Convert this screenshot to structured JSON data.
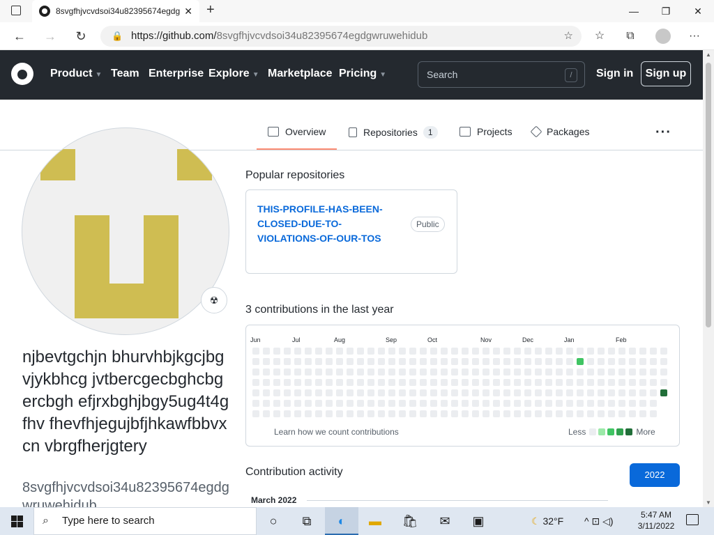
{
  "browser": {
    "tab_title": "8svgfhjvcvdsoi34u82395674egdgwruwehidub",
    "tab_close": "✕",
    "new_tab": "+",
    "url_host": "https://github.com/",
    "url_path": "8svgfhjvcvdsoi34u82395674egdgwruwehidub",
    "minimize": "—",
    "maximize": "❐",
    "close": "✕"
  },
  "header": {
    "nav": [
      "Product",
      "Team",
      "Enterprise",
      "Explore",
      "Marketplace",
      "Pricing"
    ],
    "search_placeholder": "Search",
    "search_key": "/",
    "sign_in": "Sign in",
    "sign_up": "Sign up"
  },
  "profile_tabs": {
    "overview": "Overview",
    "repositories": "Repositories",
    "repositories_count": "1",
    "projects": "Projects",
    "packages": "Packages",
    "more": "···"
  },
  "profile": {
    "name": "njbevtgchjn bhurvhbjkgcjbgvjykbhcg jvtbercgecbghcbgercbgh efjrxbghjbgy5ug4t4gfhv fhevfhjegujbfjhkawfbbvx cn vbrgfherjgtery",
    "login": "8svgfhjvcvdsoi34u82395674egdgwruwehidub",
    "status_emoji": "☢"
  },
  "popular": {
    "heading": "Popular repositories",
    "repo_name": "THIS-PROFILE-HAS-BEEN-CLOSED-DUE-TO-VIOLATIONS-OF-OUR-TOS",
    "repo_visibility": "Public"
  },
  "contributions": {
    "heading": "3 contributions in the last year",
    "months": [
      "Jun",
      "Jul",
      "Aug",
      "Sep",
      "Oct",
      "Nov",
      "Dec",
      "Jan",
      "Feb"
    ],
    "learn_link": "Learn how we count contributions",
    "less": "Less",
    "more": "More",
    "legend_colors": [
      "#ebedf0",
      "#9be9a8",
      "#40c463",
      "#30a14e",
      "#216e39"
    ],
    "active_cells": [
      {
        "week": 31,
        "day": 1,
        "level": 2
      },
      {
        "week": 39,
        "day": 4,
        "level": 4
      }
    ]
  },
  "activity": {
    "heading": "Contribution activity",
    "year_button": "2022",
    "month": "March 2022"
  },
  "taskbar": {
    "search_placeholder": "Type here to search",
    "temperature": "32°F",
    "time": "5:47 AM",
    "date": "3/11/2022"
  },
  "colors": {
    "header_bg": "#24292f",
    "link": "#0969da",
    "tab_underline": "#fd8c73",
    "avatar_fg": "#cfbd52"
  }
}
